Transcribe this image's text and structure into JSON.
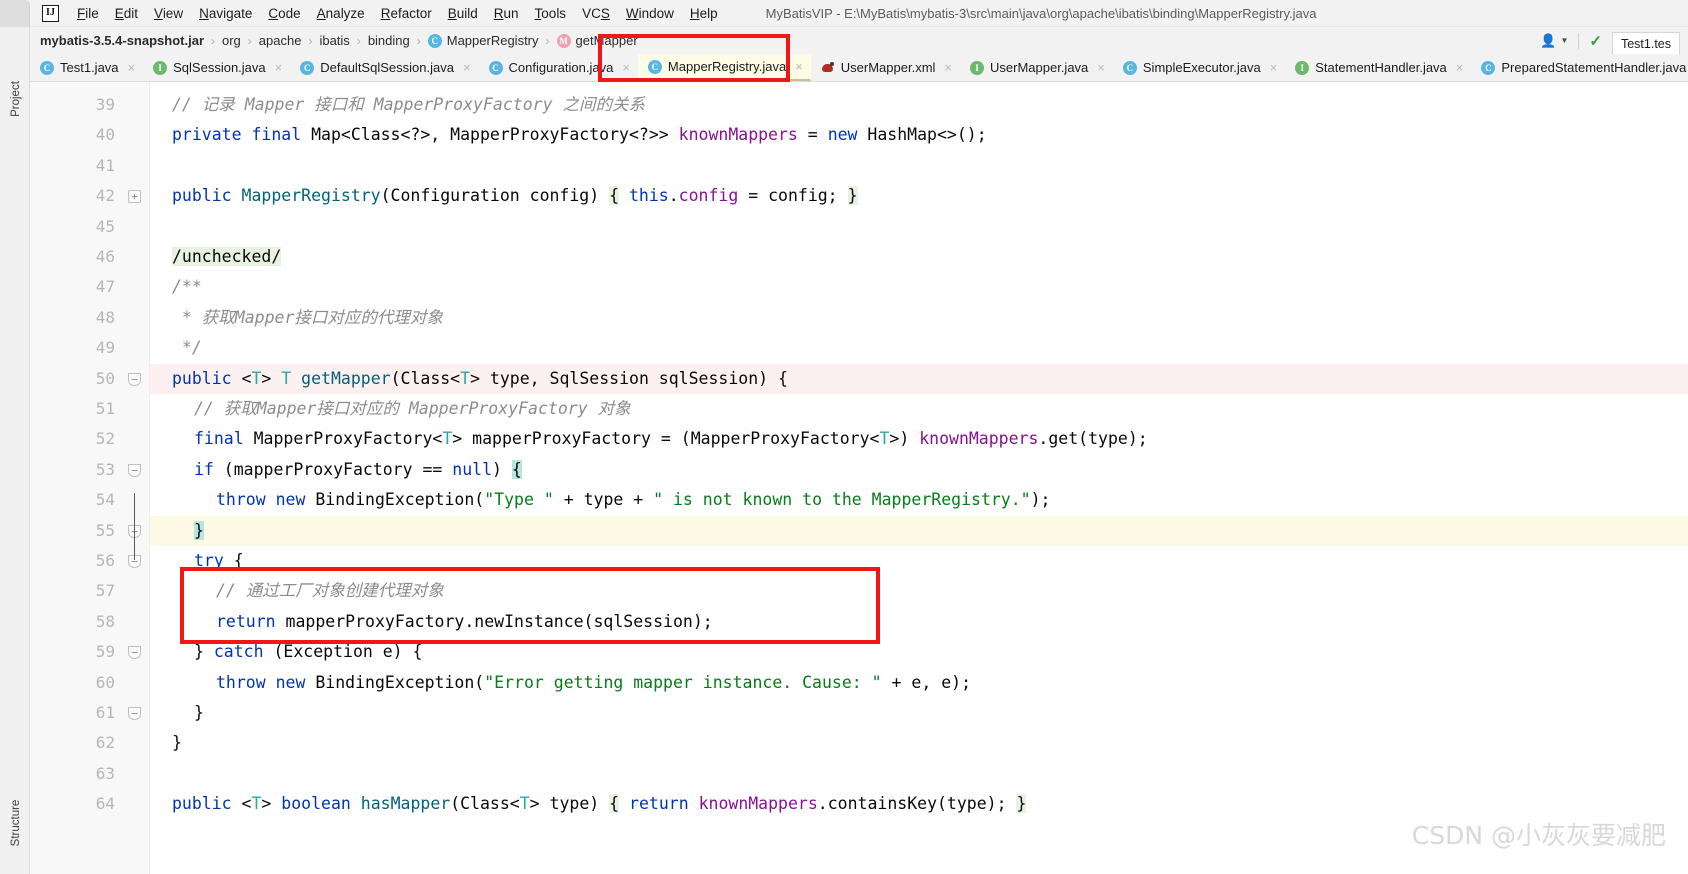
{
  "window": {
    "title": "MyBatisVIP - E:\\MyBatis\\mybatis-3\\src\\main\\java\\org\\apache\\ibatis\\binding\\MapperRegistry.java",
    "logo": "IJ"
  },
  "menubar": {
    "items": [
      {
        "label": "File",
        "mnemonic": "F"
      },
      {
        "label": "Edit",
        "mnemonic": "E"
      },
      {
        "label": "View",
        "mnemonic": "V"
      },
      {
        "label": "Navigate",
        "mnemonic": "N"
      },
      {
        "label": "Code",
        "mnemonic": "C"
      },
      {
        "label": "Analyze",
        "mnemonic": "A"
      },
      {
        "label": "Refactor",
        "mnemonic": "R"
      },
      {
        "label": "Build",
        "mnemonic": "B"
      },
      {
        "label": "Run",
        "mnemonic": "R"
      },
      {
        "label": "Tools",
        "mnemonic": "T"
      },
      {
        "label": "VCS",
        "mnemonic": "S"
      },
      {
        "label": "Window",
        "mnemonic": "W"
      },
      {
        "label": "Help",
        "mnemonic": "H"
      }
    ]
  },
  "toolwindows": {
    "project_label": "Project",
    "structure_label": "Structure"
  },
  "breadcrumb": {
    "items": [
      {
        "label": "mybatis-3.5.4-snapshot.jar",
        "bold": true,
        "badge": ""
      },
      {
        "label": "org",
        "bold": false,
        "badge": ""
      },
      {
        "label": "apache",
        "bold": false,
        "badge": ""
      },
      {
        "label": "ibatis",
        "bold": false,
        "badge": ""
      },
      {
        "label": "binding",
        "bold": false,
        "badge": ""
      },
      {
        "label": "MapperRegistry",
        "bold": false,
        "badge": "c"
      },
      {
        "label": "getMapper",
        "bold": false,
        "badge": "m"
      }
    ],
    "separator": "›",
    "right_tab_label": "Test1.tes"
  },
  "tabs": [
    {
      "label": "Test1.java",
      "icon": "c",
      "active": false
    },
    {
      "label": "SqlSession.java",
      "icon": "i",
      "active": false
    },
    {
      "label": "DefaultSqlSession.java",
      "icon": "c",
      "active": false
    },
    {
      "label": "Configuration.java",
      "icon": "c",
      "active": false
    },
    {
      "label": "MapperRegistry.java",
      "icon": "c",
      "active": true
    },
    {
      "label": "UserMapper.xml",
      "icon": "xml",
      "active": false
    },
    {
      "label": "UserMapper.java",
      "icon": "i",
      "active": false
    },
    {
      "label": "SimpleExecutor.java",
      "icon": "c",
      "active": false
    },
    {
      "label": "StatementHandler.java",
      "icon": "i",
      "active": false
    },
    {
      "label": "PreparedStatementHandler.java",
      "icon": "c",
      "active": false
    }
  ],
  "editor": {
    "file": "MapperRegistry.java",
    "lines": [
      {
        "num": "39",
        "indent": 1,
        "fold": "",
        "hl": "",
        "tokens": [
          {
            "t": "// 记录 Mapper 接口和 MapperProxyFactory 之间的关系",
            "c": "cmt"
          }
        ]
      },
      {
        "num": "40",
        "indent": 1,
        "fold": "",
        "hl": "",
        "tokens": [
          {
            "t": "private",
            "c": "kw"
          },
          {
            "t": " ",
            "c": "pl"
          },
          {
            "t": "final",
            "c": "kw"
          },
          {
            "t": " Map<Class<?>, MapperProxyFactory<?>> ",
            "c": "pl"
          },
          {
            "t": "knownMappers",
            "c": "fld"
          },
          {
            "t": " = ",
            "c": "pl"
          },
          {
            "t": "new",
            "c": "kw"
          },
          {
            "t": " HashMap<>();",
            "c": "pl"
          }
        ]
      },
      {
        "num": "41",
        "indent": 1,
        "fold": "",
        "hl": "",
        "tokens": []
      },
      {
        "num": "42",
        "indent": 1,
        "fold": "plus",
        "hl": "",
        "tokens": [
          {
            "t": "public",
            "c": "kw"
          },
          {
            "t": " ",
            "c": "pl"
          },
          {
            "t": "MapperRegistry",
            "c": "fn"
          },
          {
            "t": "(Configuration config) ",
            "c": "pl"
          },
          {
            "t": "{",
            "c": "hl-green"
          },
          {
            "t": " ",
            "c": "pl"
          },
          {
            "t": "this",
            "c": "kw"
          },
          {
            "t": ".",
            "c": "pl"
          },
          {
            "t": "config",
            "c": "fld"
          },
          {
            "t": " = config; ",
            "c": "pl"
          },
          {
            "t": "}",
            "c": "hl-green"
          }
        ]
      },
      {
        "num": "45",
        "indent": 1,
        "fold": "",
        "hl": "",
        "tokens": []
      },
      {
        "num": "46",
        "indent": 1,
        "fold": "",
        "hl": "",
        "tokens": [
          {
            "t": "/unchecked/",
            "c": "hl-green"
          }
        ]
      },
      {
        "num": "47",
        "indent": 1,
        "fold": "",
        "hl": "",
        "tokens": [
          {
            "t": "/**",
            "c": "cmt"
          }
        ]
      },
      {
        "num": "48",
        "indent": 1,
        "fold": "",
        "hl": "",
        "tokens": [
          {
            "t": " * 获取Mapper接口对应的代理对象",
            "c": "cmt"
          }
        ]
      },
      {
        "num": "49",
        "indent": 1,
        "fold": "",
        "hl": "",
        "tokens": [
          {
            "t": " */",
            "c": "cmt"
          }
        ]
      },
      {
        "num": "50",
        "indent": 1,
        "fold": "minus",
        "hl": "pink",
        "tokens": [
          {
            "t": "public",
            "c": "kw"
          },
          {
            "t": " <",
            "c": "pl"
          },
          {
            "t": "T",
            "c": "cls"
          },
          {
            "t": "> ",
            "c": "pl"
          },
          {
            "t": "T",
            "c": "cls"
          },
          {
            "t": " ",
            "c": "pl"
          },
          {
            "t": "getMapper",
            "c": "fn"
          },
          {
            "t": "(Class<",
            "c": "pl"
          },
          {
            "t": "T",
            "c": "cls"
          },
          {
            "t": "> type, SqlSession sqlSession) {",
            "c": "pl"
          }
        ]
      },
      {
        "num": "51",
        "indent": 2,
        "fold": "",
        "hl": "",
        "tokens": [
          {
            "t": "// 获取Mapper接口对应的 MapperProxyFactory 对象",
            "c": "cmt"
          }
        ]
      },
      {
        "num": "52",
        "indent": 2,
        "fold": "",
        "hl": "",
        "tokens": [
          {
            "t": "final",
            "c": "kw"
          },
          {
            "t": " MapperProxyFactory<",
            "c": "pl"
          },
          {
            "t": "T",
            "c": "cls"
          },
          {
            "t": "> mapperProxyFactory = (MapperProxyFactory<",
            "c": "pl"
          },
          {
            "t": "T",
            "c": "cls"
          },
          {
            "t": ">) ",
            "c": "pl"
          },
          {
            "t": "knownMappers",
            "c": "fld"
          },
          {
            "t": ".get(type);",
            "c": "pl"
          }
        ]
      },
      {
        "num": "53",
        "indent": 2,
        "fold": "minus",
        "hl": "",
        "tokens": [
          {
            "t": "if",
            "c": "kw"
          },
          {
            "t": " (mapperProxyFactory == ",
            "c": "pl"
          },
          {
            "t": "null",
            "c": "kw"
          },
          {
            "t": ") ",
            "c": "pl"
          },
          {
            "t": "{",
            "c": "hl-cyan"
          }
        ]
      },
      {
        "num": "54",
        "indent": 3,
        "fold": "",
        "hl": "",
        "tokens": [
          {
            "t": "throw",
            "c": "kw"
          },
          {
            "t": " ",
            "c": "pl"
          },
          {
            "t": "new",
            "c": "kw"
          },
          {
            "t": " BindingException(",
            "c": "pl"
          },
          {
            "t": "\"Type \"",
            "c": "str"
          },
          {
            "t": " + type + ",
            "c": "pl"
          },
          {
            "t": "\" is not known to the MapperRegistry.\"",
            "c": "str"
          },
          {
            "t": ");",
            "c": "pl"
          }
        ]
      },
      {
        "num": "55",
        "indent": 2,
        "fold": "minus",
        "hl": "yellow",
        "tokens": [
          {
            "t": "}",
            "c": "hl-cyan"
          }
        ]
      },
      {
        "num": "56",
        "indent": 2,
        "fold": "minus",
        "hl": "",
        "tokens": [
          {
            "t": "try",
            "c": "kw"
          },
          {
            "t": " {",
            "c": "pl"
          }
        ]
      },
      {
        "num": "57",
        "indent": 3,
        "fold": "",
        "hl": "",
        "tokens": [
          {
            "t": "// 通过工厂对象创建代理对象",
            "c": "cmt"
          }
        ]
      },
      {
        "num": "58",
        "indent": 3,
        "fold": "",
        "hl": "",
        "tokens": [
          {
            "t": "return",
            "c": "kw"
          },
          {
            "t": " mapperProxyFactory.newInstance(sqlSession);",
            "c": "pl"
          }
        ]
      },
      {
        "num": "59",
        "indent": 2,
        "fold": "minus",
        "hl": "",
        "tokens": [
          {
            "t": "} ",
            "c": "pl"
          },
          {
            "t": "catch",
            "c": "kw"
          },
          {
            "t": " (Exception e) {",
            "c": "pl"
          }
        ]
      },
      {
        "num": "60",
        "indent": 3,
        "fold": "",
        "hl": "",
        "tokens": [
          {
            "t": "throw",
            "c": "kw"
          },
          {
            "t": " ",
            "c": "pl"
          },
          {
            "t": "new",
            "c": "kw"
          },
          {
            "t": " BindingException(",
            "c": "pl"
          },
          {
            "t": "\"Error getting mapper instance. Cause: \"",
            "c": "str"
          },
          {
            "t": " + e, e);",
            "c": "pl"
          }
        ]
      },
      {
        "num": "61",
        "indent": 2,
        "fold": "minus",
        "hl": "",
        "tokens": [
          {
            "t": "}",
            "c": "pl"
          }
        ]
      },
      {
        "num": "62",
        "indent": 1,
        "fold": "",
        "hl": "",
        "tokens": [
          {
            "t": "}",
            "c": "pl"
          }
        ]
      },
      {
        "num": "63",
        "indent": 1,
        "fold": "",
        "hl": "",
        "tokens": []
      },
      {
        "num": "64",
        "indent": 1,
        "fold": "",
        "hl": "",
        "tokens": [
          {
            "t": "public",
            "c": "kw"
          },
          {
            "t": " <",
            "c": "pl"
          },
          {
            "t": "T",
            "c": "cls"
          },
          {
            "t": "> ",
            "c": "pl"
          },
          {
            "t": "boolean",
            "c": "kw"
          },
          {
            "t": " ",
            "c": "pl"
          },
          {
            "t": "hasMapper",
            "c": "fn"
          },
          {
            "t": "(Class<",
            "c": "pl"
          },
          {
            "t": "T",
            "c": "cls"
          },
          {
            "t": "> type) ",
            "c": "pl"
          },
          {
            "t": "{",
            "c": "hl-green"
          },
          {
            "t": " ",
            "c": "pl"
          },
          {
            "t": "return",
            "c": "kw"
          },
          {
            "t": " ",
            "c": "pl"
          },
          {
            "t": "knownMappers",
            "c": "fld"
          },
          {
            "t": ".containsKey(type); ",
            "c": "pl"
          },
          {
            "t": "}",
            "c": "hl-green"
          }
        ]
      }
    ]
  },
  "annotations": {
    "red_box_tab_target": "MapperRegistry.java",
    "red_box_code_target": "// 通过工厂对象创建代理对象 / return mapperProxyFactory.newInstance(sqlSession);",
    "box_color": "#f21616"
  },
  "watermark": {
    "text": "CSDN @小灰灰要减肥"
  }
}
